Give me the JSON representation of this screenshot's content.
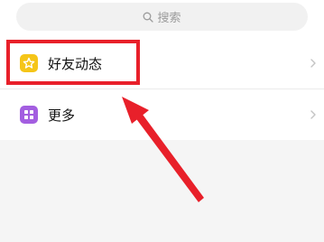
{
  "search": {
    "placeholder": "搜索",
    "icon": "search-icon"
  },
  "menu": {
    "items": [
      {
        "label": "好友动态",
        "icon": "star-icon",
        "icon_color": "#f5c518"
      },
      {
        "label": "更多",
        "icon": "grid-icon",
        "icon_color": "#a35ee0"
      }
    ]
  },
  "annotation": {
    "highlight_color": "#e8202a"
  }
}
